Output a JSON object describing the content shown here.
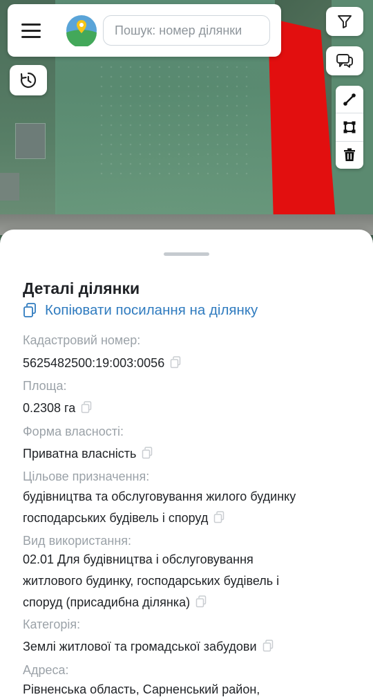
{
  "search": {
    "placeholder": "Пошук: номер ділянки"
  },
  "icons": {
    "menu": "menu-icon",
    "logo": "map-pin-logo",
    "history": "history-icon",
    "filter": "filter-icon",
    "chat": "chat-icon",
    "line_tool": "line-draw-icon",
    "polygon_tool": "polygon-draw-icon",
    "delete_tool": "trash-icon",
    "copy": "copy-icon"
  },
  "colors": {
    "accent_link": "#2f7bbf",
    "selected_parcel": "#e20f0f",
    "label": "#9ba2a8"
  },
  "details": {
    "title": "Деталі ділянки",
    "copy_link_label": "Копіювати посилання на ділянку",
    "cadastral_label": "Кадастровий номер:",
    "cadastral_value": "5625482500:19:003:0056",
    "area_label": "Площа:",
    "area_value": "0.2308 га",
    "ownership_label": "Форма власності:",
    "ownership_value": "Приватна власність",
    "purpose_label": "Цільове призначення:",
    "purpose_line1": "будівництва та обслуговування жилого будинку",
    "purpose_line2": "господарських будівель і споруд",
    "usage_label": "Вид використання:",
    "usage_line1": "02.01 Для будівництва і обслуговування",
    "usage_line2": "житлового будинку, господарських будівель і",
    "usage_line3": "споруд (присадибна ділянка)",
    "category_label": "Категорія:",
    "category_value": "Землі житлової та громадської забудови",
    "address_label": "Адреса:",
    "address_value": "Рівненська область, Сарненський район,"
  }
}
